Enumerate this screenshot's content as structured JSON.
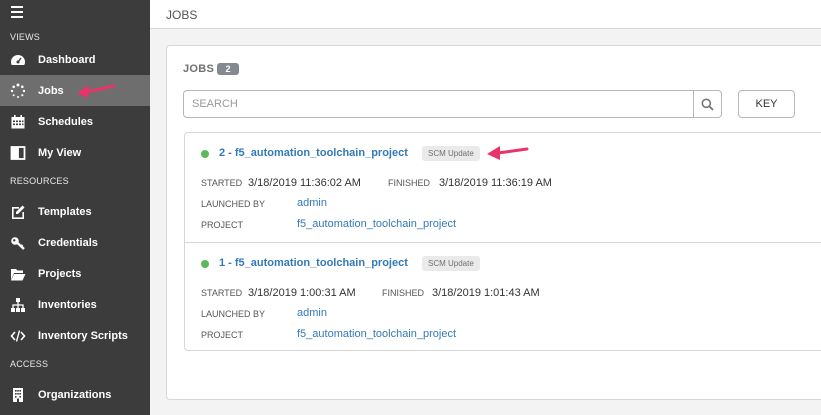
{
  "sidebar": {
    "sections": {
      "views": "VIEWS",
      "resources": "RESOURCES",
      "access": "ACCESS"
    },
    "items": [
      {
        "label": "Dashboard",
        "icon": "dashboard-icon"
      },
      {
        "label": "Jobs",
        "icon": "spinner-icon",
        "active": true
      },
      {
        "label": "Schedules",
        "icon": "calendar-icon"
      },
      {
        "label": "My View",
        "icon": "columns-icon"
      },
      {
        "label": "Templates",
        "icon": "edit-icon"
      },
      {
        "label": "Credentials",
        "icon": "key-icon"
      },
      {
        "label": "Projects",
        "icon": "folder-icon"
      },
      {
        "label": "Inventories",
        "icon": "sitemap-icon"
      },
      {
        "label": "Inventory Scripts",
        "icon": "code-icon"
      },
      {
        "label": "Organizations",
        "icon": "building-icon"
      }
    ]
  },
  "header": {
    "title": "JOBS"
  },
  "panel": {
    "title": "JOBS",
    "count": "2",
    "search_placeholder": "SEARCH",
    "key_label": "KEY"
  },
  "labels": {
    "started": "STARTED",
    "finished": "FINISHED",
    "launched_by": "LAUNCHED BY",
    "project": "PROJECT"
  },
  "jobs": [
    {
      "name": "2 - f5_automation_toolchain_project",
      "tag": "SCM Update",
      "started": "3/18/2019 11:36:02 AM",
      "finished": "3/18/2019 11:36:19 AM",
      "launched_by": "admin",
      "project": "f5_automation_toolchain_project",
      "status": "successful"
    },
    {
      "name": "1 - f5_automation_toolchain_project",
      "tag": "SCM Update",
      "started": "3/18/2019 1:00:31 AM",
      "finished": "3/18/2019 1:01:43 AM",
      "launched_by": "admin",
      "project": "f5_automation_toolchain_project",
      "status": "successful"
    }
  ],
  "colors": {
    "sidebar_bg": "#3c3c3c",
    "active_bg": "#6e6e6e",
    "link": "#337ab7",
    "success": "#5cb85c",
    "annotation_arrow": "#e8336b"
  }
}
